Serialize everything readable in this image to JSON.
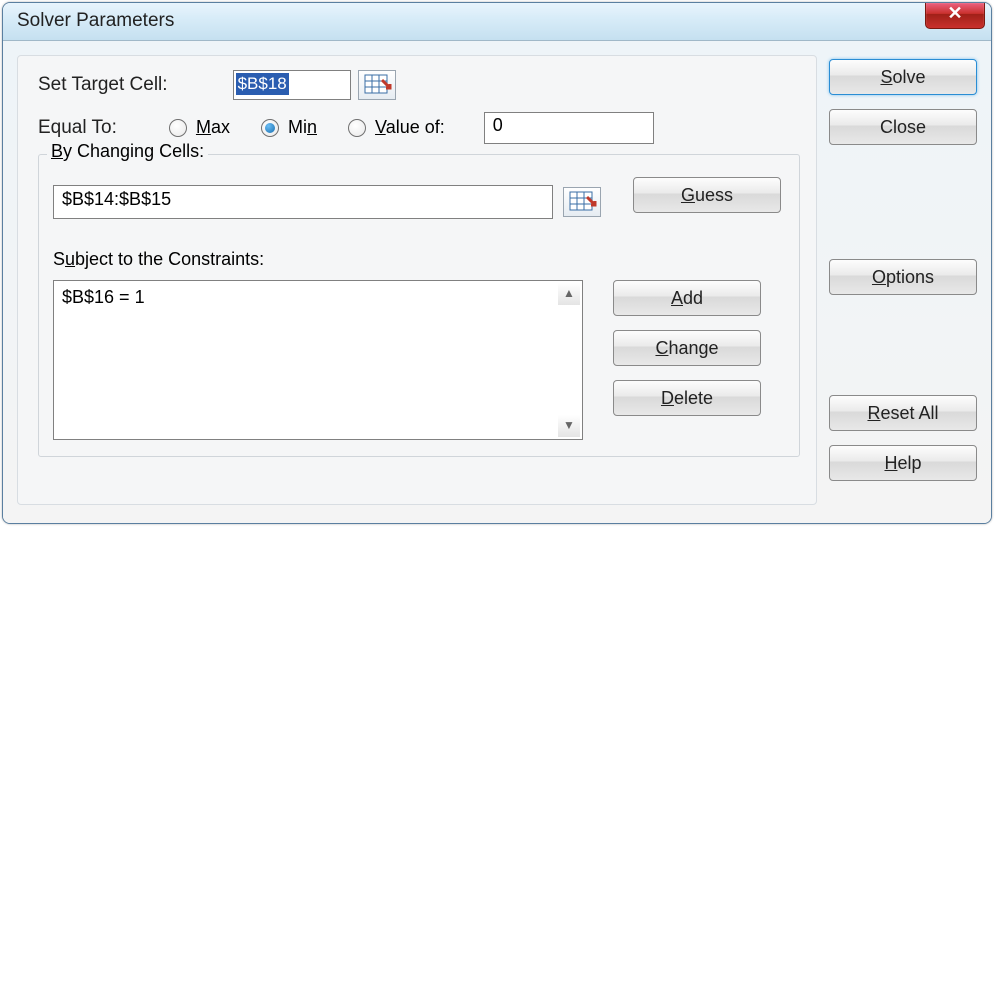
{
  "window": {
    "title": "Solver Parameters"
  },
  "labels": {
    "set_target": "Set Target Cell:",
    "equal_to": "Equal To:",
    "by_changing": "By Changing Cells:",
    "subject_to": "Subject to the Constraints:"
  },
  "target_cell": {
    "value": "$B$18"
  },
  "equal_to": {
    "options": {
      "max": "Max",
      "min": "Min",
      "value_of": "Value of:"
    },
    "selected": "min",
    "value_of_input": "0"
  },
  "changing_cells": {
    "value": "$B$14:$B$15"
  },
  "constraints": {
    "items": [
      "$B$16 = 1"
    ]
  },
  "buttons": {
    "solve": "Solve",
    "close": "Close",
    "options": "Options",
    "reset_all": "Reset All",
    "help": "Help",
    "guess": "Guess",
    "add": "Add",
    "change": "Change",
    "delete": "Delete"
  },
  "accelerators": {
    "solve": "S",
    "options": "O",
    "reset_all": "R",
    "help": "H",
    "max": "M",
    "min": "n",
    "value_of": "V",
    "by": "B",
    "subject": "u",
    "guess": "G",
    "add": "A",
    "change": "C",
    "delete": "D"
  }
}
